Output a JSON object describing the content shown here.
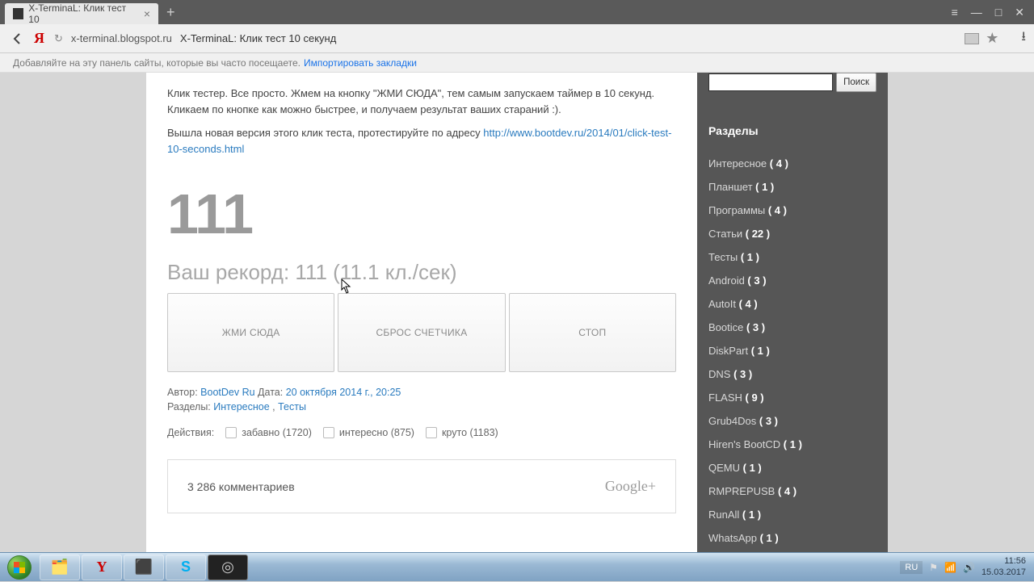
{
  "browser": {
    "tab_title": "X-TerminaL: Клик тест 10",
    "url_domain": "x-terminal.blogspot.ru",
    "url_title": "X-TerminaL: Клик тест 10 секунд",
    "bookmark_prompt": "Добавляйте на эту панель сайты, которые вы часто посещаете.",
    "import_bookmarks": "Импортировать закладки"
  },
  "content": {
    "intro_1": "Клик тестер. Все просто. Жмем на кнопку \"ЖМИ СЮДА\", тем самым запускаем таймер в 10 секунд. Кликаем по кнопке как можно быстрее, и получаем результат ваших стараний :).",
    "intro_2_prefix": "Вышла новая версия этого клик теста, протестируйте по адресу ",
    "intro_2_link": "http://www.bootdev.ru/2014/01/click-test-10-seconds.html",
    "counter": "111",
    "record": "Ваш рекорд: 111 (11.1 кл./сек)",
    "btn_click": "ЖМИ СЮДА",
    "btn_reset": "СБРОС СЧЕТЧИКА",
    "btn_stop": "СТОП",
    "meta_author_label": "Автор:",
    "meta_author": "BootDev Ru",
    "meta_date_label": "Дата:",
    "meta_date": "20 октября 2014 г., 20:25",
    "meta_sections_label": "Разделы:",
    "meta_section_1": "Интересное",
    "meta_section_2": "Тесты",
    "actions_label": "Действия:",
    "action_funny": "забавно (1720)",
    "action_interesting": "интересно (875)",
    "action_cool": "круто (1183)",
    "comments_count": "3 286 комментариев",
    "gplus": "Google+"
  },
  "sidebar": {
    "search_btn": "Поиск",
    "sections_title": "Разделы",
    "categories": [
      {
        "name": "Интересное",
        "count": "( 4 )"
      },
      {
        "name": "Планшет",
        "count": "( 1 )"
      },
      {
        "name": "Программы",
        "count": "( 4 )"
      },
      {
        "name": "Статьи",
        "count": "( 22 )"
      },
      {
        "name": "Тесты",
        "count": "( 1 )"
      },
      {
        "name": "Android",
        "count": "( 3 )"
      },
      {
        "name": "AutoIt",
        "count": "( 4 )"
      },
      {
        "name": "Bootice",
        "count": "( 3 )"
      },
      {
        "name": "DiskPart",
        "count": "( 1 )"
      },
      {
        "name": "DNS",
        "count": "( 3 )"
      },
      {
        "name": "FLASH",
        "count": "( 9 )"
      },
      {
        "name": "Grub4Dos",
        "count": "( 3 )"
      },
      {
        "name": "Hiren's BootCD",
        "count": "( 1 )"
      },
      {
        "name": "QEMU",
        "count": "( 1 )"
      },
      {
        "name": "RMPREPUSB",
        "count": "( 4 )"
      },
      {
        "name": "RunAll",
        "count": "( 1 )"
      },
      {
        "name": "WhatsApp",
        "count": "( 1 )"
      }
    ]
  },
  "tray": {
    "lang": "RU",
    "time": "11:56",
    "date": "15.03.2017"
  }
}
